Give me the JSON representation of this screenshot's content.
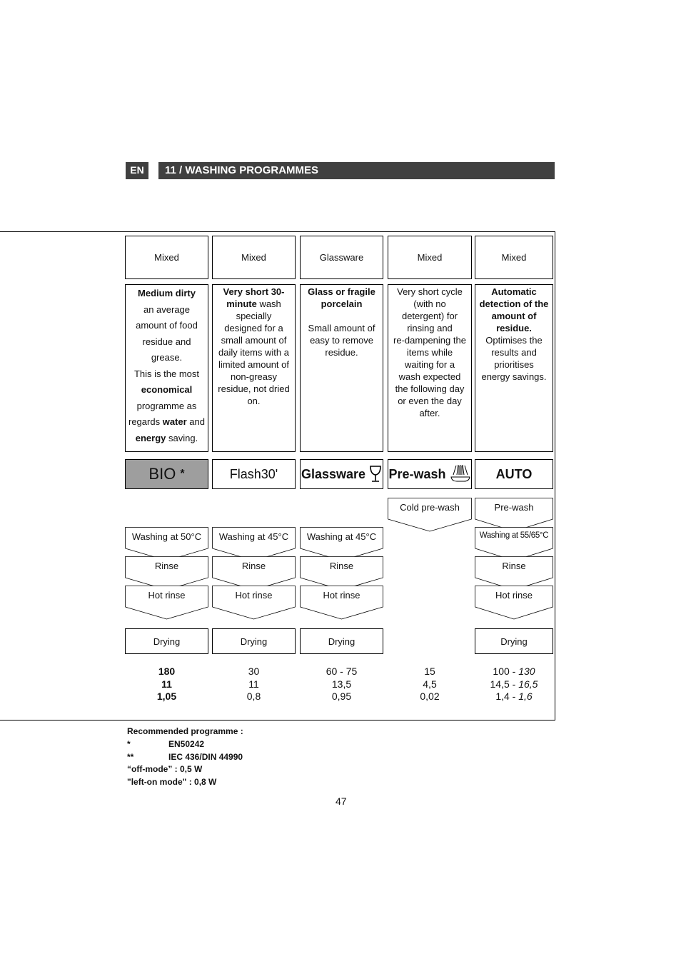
{
  "header": {
    "lang": "EN",
    "section_title": "11 / WASHING PROGRAMMES"
  },
  "columns": [
    {
      "load_type": "Mixed",
      "description": {
        "segments": [
          {
            "t": "Medium dirty",
            "b": true
          },
          {
            "t": "\nan average\namount of food\nresidue and\ngrease.\nThis is the most\n",
            "b": false
          },
          {
            "t": "economical",
            "b": true
          },
          {
            "t": "\nprogramme as\nregards ",
            "b": false
          },
          {
            "t": "water",
            "b": true
          },
          {
            "t": " and\n",
            "b": false
          },
          {
            "t": "energy",
            "b": true
          },
          {
            "t": " saving.",
            "b": false
          }
        ]
      },
      "programme": "BIO",
      "programme_mark": "*",
      "programme_icon": "",
      "steps": [
        "",
        "Washing at 50°C",
        "Rinse",
        "Hot rinse"
      ],
      "drying": "Drying",
      "values": [
        "180",
        "11",
        "1,05"
      ],
      "values_bold": true
    },
    {
      "load_type": "Mixed",
      "description": {
        "segments": [
          {
            "t": "Very short 30-\nminute",
            "b": true
          },
          {
            "t": " wash\nspecially\ndesigned for a\nsmall amount of\ndaily items with a\nlimited amount of\nnon-greasy\nresidue, not dried\non.",
            "b": false
          }
        ]
      },
      "programme": "Flash30'",
      "programme_mark": "",
      "programme_icon": "",
      "steps": [
        "",
        "Washing at 45°C",
        "Rinse",
        "Hot rinse"
      ],
      "drying": "Drying",
      "values": [
        "30",
        "11",
        "0,8"
      ],
      "values_bold": false
    },
    {
      "load_type": "Glassware",
      "description": {
        "segments": [
          {
            "t": "Glass or fragile\nporcelain",
            "b": true
          },
          {
            "t": "\n\nSmall amount of\neasy to remove\nresidue.",
            "b": false
          }
        ]
      },
      "programme": "Glassware",
      "programme_mark": "",
      "programme_icon": "wine-glass-icon",
      "steps": [
        "",
        "Washing at 45°C",
        "Rinse",
        "Hot rinse"
      ],
      "drying": "Drying",
      "values": [
        "60 - 75",
        "13,5",
        "0,95"
      ],
      "values_bold": false
    },
    {
      "load_type": "Mixed",
      "description": {
        "segments": [
          {
            "t": "Very short cycle\n(with no\ndetergent) for\nrinsing and\nre-dampening the\nitems while\nwaiting for a\nwash expected\nthe following day\nor even the day\nafter.",
            "b": false
          }
        ]
      },
      "programme": "Pre-wash",
      "programme_mark": "",
      "programme_icon": "shower-plate-icon",
      "steps": [
        "Cold pre-wash",
        "",
        "",
        ""
      ],
      "drying": "",
      "values": [
        "15",
        "4,5",
        "0,02"
      ],
      "values_bold": false
    },
    {
      "load_type": "Mixed",
      "description": {
        "segments": [
          {
            "t": "Automatic\ndetection of the\namount of\nresidue.",
            "b": true
          },
          {
            "t": "\nOptimises the\nresults and\nprioritises\nenergy savings.",
            "b": false
          }
        ]
      },
      "programme": "AUTO",
      "programme_mark": "",
      "programme_icon": "",
      "steps": [
        "Pre-wash",
        "Washing at 55/65°C",
        "Rinse",
        "Hot rinse"
      ],
      "drying": "Drying",
      "values": [
        [
          "100 - ",
          "130"
        ],
        [
          "14,5 - ",
          "16,5"
        ],
        [
          "1,4 - ",
          "1,6"
        ]
      ],
      "values_bold": false
    }
  ],
  "notes": {
    "recommended": "Recommended programme :",
    "star1_mark": "*",
    "star1_text": "EN50242",
    "star2_mark": "**",
    "star2_text": "IEC 436/DIN 44990",
    "off_mode": "“off-mode” : 0,5 W",
    "left_on_mode": "\"left-on mode\" : 0,8 W"
  },
  "page_number": "47"
}
